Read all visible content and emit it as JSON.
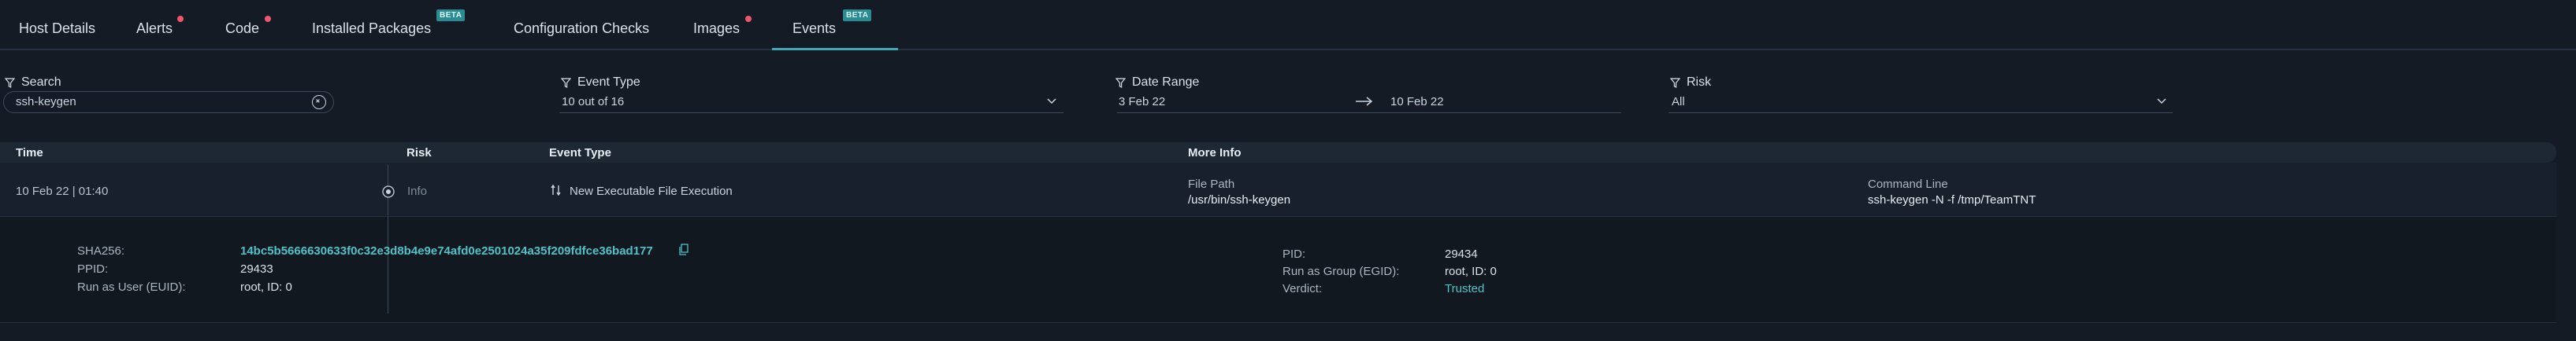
{
  "tabs": [
    {
      "label": "Host Details"
    },
    {
      "label": "Alerts"
    },
    {
      "label": "Code"
    },
    {
      "label": "Installed Packages",
      "badge": "BETA"
    },
    {
      "label": "Configuration Checks"
    },
    {
      "label": "Images"
    },
    {
      "label": "Events",
      "badge": "BETA",
      "active": true
    }
  ],
  "filters": {
    "search": {
      "label": "Search",
      "value": "ssh-keygen"
    },
    "event_type": {
      "label": "Event Type",
      "value": "10 out of 16"
    },
    "date_range": {
      "label": "Date Range",
      "from": "3 Feb 22",
      "to": "10 Feb 22"
    },
    "risk": {
      "label": "Risk",
      "value": "All"
    }
  },
  "table": {
    "headers": {
      "time": "Time",
      "risk": "Risk",
      "event_type": "Event Type",
      "more_info": "More Info"
    },
    "row": {
      "time": "10 Feb 22 | 01:40",
      "risk": "Info",
      "event_type": "New Executable File Execution",
      "file_path_label": "File Path",
      "file_path": "/usr/bin/ssh-keygen",
      "command_line_label": "Command Line",
      "command_line": "ssh-keygen -N -f /tmp/TeamTNT"
    },
    "details": {
      "sha256_label": "SHA256:",
      "sha256": "14bc5b5666630633f0c32e3d8b4e9e74afd0e2501024a35f209fdfce36bad177",
      "ppid_label": "PPID:",
      "ppid": "29433",
      "euid_label": "Run as User (EUID):",
      "euid": "root, ID: 0",
      "pid_label": "PID:",
      "pid": "29434",
      "egid_label": "Run as Group (EGID):",
      "egid": "root, ID: 0",
      "verdict_label": "Verdict:",
      "verdict": "Trusted"
    }
  },
  "colors": {
    "accent": "#3fa7b3",
    "dot": "#f0566e",
    "verdict": "#4fc2c8"
  }
}
